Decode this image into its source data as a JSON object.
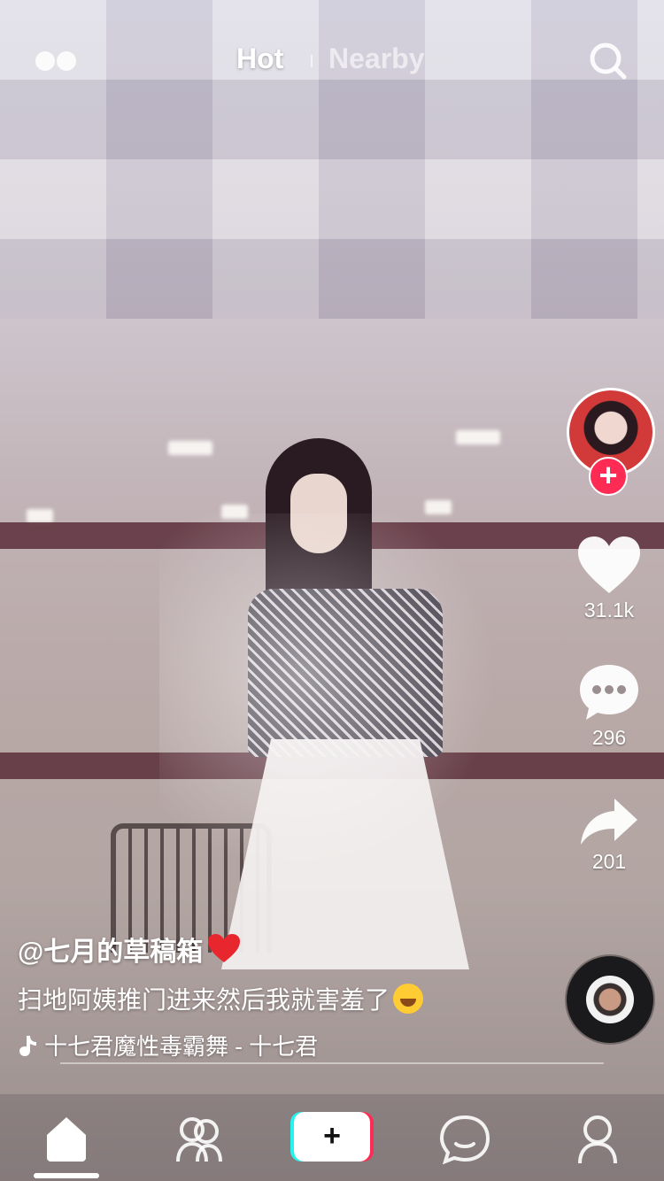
{
  "topbar": {
    "tabs": [
      {
        "label": "Hot",
        "active": true
      },
      {
        "label": "Nearby",
        "active": false
      }
    ],
    "left_icon": "dots-icon",
    "right_icon": "search-icon"
  },
  "sidebar": {
    "author_avatar_icon": "avatar",
    "follow_label": "+",
    "like_count": "31.1k",
    "comment_count": "296",
    "share_count": "201",
    "music_disc_icon": "music-disc"
  },
  "caption": {
    "author": "@七月的草稿箱",
    "description": "扫地阿姨推门进来然后我就害羞了",
    "music": "十七君魔性毒霸舞 - 十七君"
  },
  "bottom_nav": {
    "items": [
      "home-icon",
      "friends-icon",
      "add-icon",
      "messages-icon",
      "profile-icon"
    ],
    "add_label": "+"
  },
  "colors": {
    "accent": "#fe2c55",
    "cyan": "#25f4ee",
    "white": "#ffffff"
  }
}
